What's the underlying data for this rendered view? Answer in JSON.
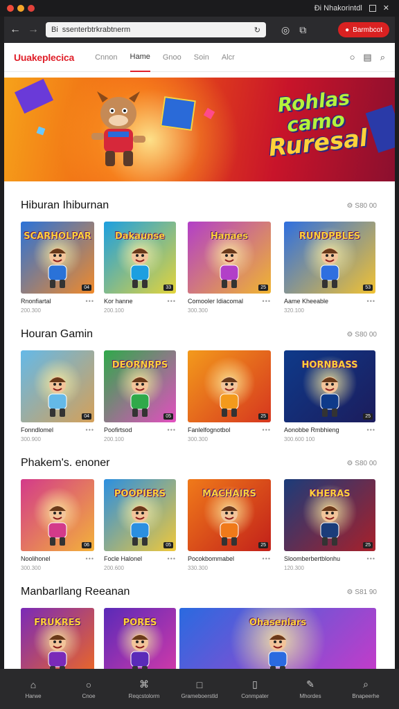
{
  "window": {
    "dot_colors": [
      "#ee4b3b",
      "#f4a529",
      "#e1413a"
    ],
    "system_text": "Đi Nhakorintdl"
  },
  "browser": {
    "url": "ssenterbtrkrabtnerm",
    "url_prefix": "Bi",
    "account_label": "Barmbcot"
  },
  "site": {
    "logo": "Uuakeplecica",
    "nav": [
      "Cnnon",
      "Hame",
      "Gnoo",
      "Soin",
      "Alcr"
    ],
    "active_nav": "Hame"
  },
  "banner": {
    "title_lines": [
      "Rohlas",
      "camo",
      "Ruresal"
    ]
  },
  "sections": [
    {
      "title": "Hiburan Ihiburnan",
      "more": "S80 00",
      "items": [
        {
          "art": "SCARHOLPAR",
          "name": "Rnonfiartal",
          "meta": "200.300",
          "badge": "04",
          "colors": [
            "#2a72d8",
            "#f18a2a"
          ]
        },
        {
          "art": "Dakaunse",
          "name": "Kor hanne",
          "meta": "200.100",
          "badge": "33",
          "colors": [
            "#1c9fe0",
            "#e4d43a"
          ]
        },
        {
          "art": "Hanaes",
          "name": "Comooler Idiacomal",
          "meta": "300.300",
          "badge": "25",
          "colors": [
            "#b23fc8",
            "#f0b530"
          ]
        },
        {
          "art": "RUNDPBLES",
          "name": "Aame Kheeable",
          "meta": "320.100",
          "badge": "53",
          "colors": [
            "#2e6fe0",
            "#f2c232"
          ]
        }
      ]
    },
    {
      "title": "Houran Gamin",
      "more": "S80 00",
      "items": [
        {
          "art": "",
          "name": "Fonndlomel",
          "meta": "300.900",
          "badge": "04",
          "colors": [
            "#64b9e8",
            "#d5a058"
          ]
        },
        {
          "art": "DEORNRPS",
          "name": "Poofirtsod",
          "meta": "200.100",
          "badge": "05",
          "colors": [
            "#2fa94a",
            "#e34ec0"
          ]
        },
        {
          "art": "",
          "name": "Fanlelfognotbol",
          "meta": "300.300",
          "badge": "25",
          "colors": [
            "#f39a1c",
            "#d6361e"
          ]
        },
        {
          "art": "HORNBASS",
          "name": "Aonobbe Rmbhieng",
          "meta": "300.600 100",
          "badge": "25",
          "colors": [
            "#0e3a8a",
            "#1c1c5c"
          ]
        }
      ]
    },
    {
      "title": "Phakem's. enoner",
      "more": "S80 00",
      "items": [
        {
          "art": "",
          "name": "Noolihonel",
          "meta": "300.300",
          "badge": "06",
          "colors": [
            "#d33a8a",
            "#f3b23a"
          ]
        },
        {
          "art": "POOPIERS",
          "name": "Focle Halonel",
          "meta": "200.600",
          "badge": "05",
          "colors": [
            "#2b8fe0",
            "#f0c83a"
          ]
        },
        {
          "art": "MACHAIRS",
          "name": "Pocokbommabel",
          "meta": "330.300",
          "badge": "25",
          "colors": [
            "#f07a1a",
            "#c2201a"
          ]
        },
        {
          "art": "KHERAS",
          "name": "Sloomberbertblonhu",
          "meta": "120.300",
          "badge": "25",
          "colors": [
            "#1b3c7a",
            "#a8202a"
          ]
        }
      ]
    },
    {
      "title": "Manbarllang Reeanan",
      "more": "S81 90",
      "items": [
        {
          "art": "FRUKRES",
          "name": "",
          "meta": "",
          "badge": "",
          "colors": [
            "#7a2ab8",
            "#f06a20"
          ]
        },
        {
          "art": "PORES",
          "name": "",
          "meta": "",
          "badge": "",
          "colors": [
            "#5a2ab8",
            "#d63aa8"
          ]
        },
        {
          "art": "Ohasenlars",
          "name": "",
          "meta": "",
          "badge": "",
          "colors": [
            "#2a6ae0",
            "#c83ac8"
          ]
        }
      ]
    }
  ],
  "tabbar": [
    "Harwe",
    "Cnoe",
    "Reqcstolorm",
    "Grameboerstld",
    "Conmpater",
    "Mhordes",
    "Bnapeerhe"
  ]
}
